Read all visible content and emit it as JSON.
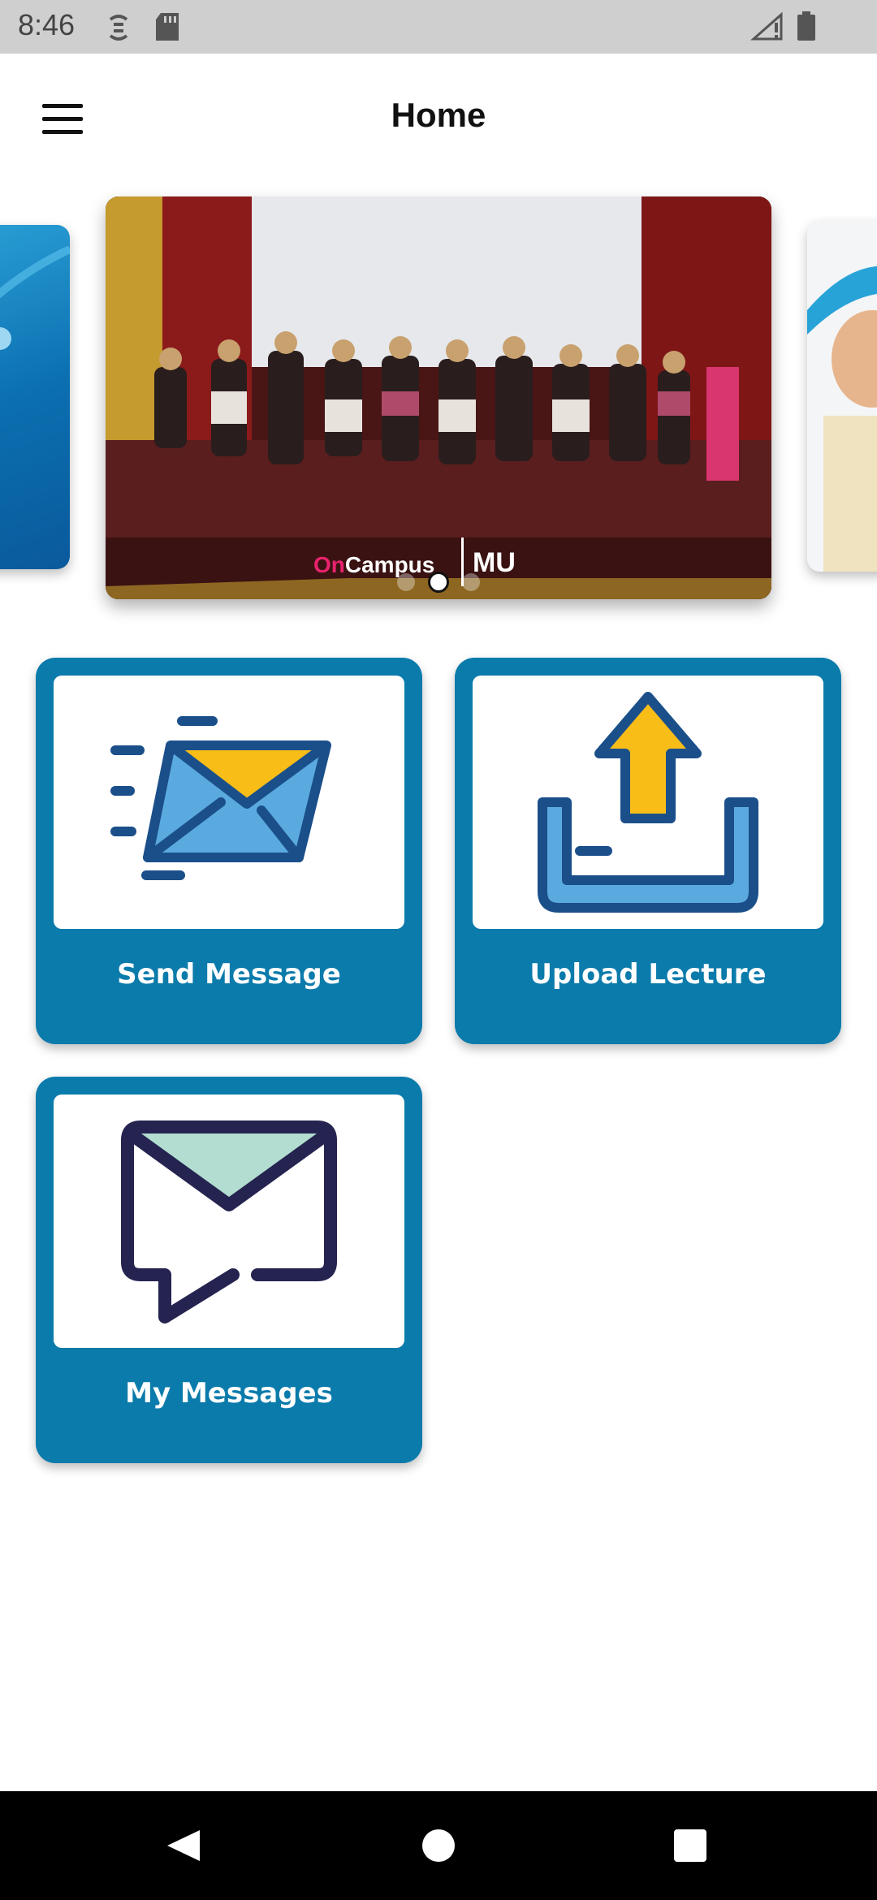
{
  "status_bar": {
    "time": "8:46",
    "icons": [
      "sync-icon",
      "sd-card-icon",
      "signal-icon",
      "battery-icon"
    ]
  },
  "app_bar": {
    "title": "Home",
    "menu_icon": "hamburger-menu-icon"
  },
  "carousel": {
    "slides": [
      {
        "name": "slide-previous"
      },
      {
        "name": "slide-current",
        "caption_brand_1": "OnCampus",
        "caption_brand_2": "MU"
      },
      {
        "name": "slide-next"
      }
    ],
    "dot_count": 3,
    "active_index": 1
  },
  "tiles": [
    {
      "label": "Send Message",
      "icon": "send-mail-icon"
    },
    {
      "label": "Upload Lecture",
      "icon": "upload-icon"
    },
    {
      "label": "My Messages",
      "icon": "message-inbox-icon"
    }
  ],
  "colors": {
    "tile_background": "#0b7bab",
    "accent_yellow": "#f9bd18",
    "icon_dark_blue": "#1b4f8a",
    "icon_light_blue": "#5aaae0",
    "icon_navy": "#252450",
    "icon_mint": "#b2ddd0"
  },
  "nav_bar": {
    "buttons": [
      "back-icon",
      "home-icon",
      "recents-icon"
    ]
  }
}
